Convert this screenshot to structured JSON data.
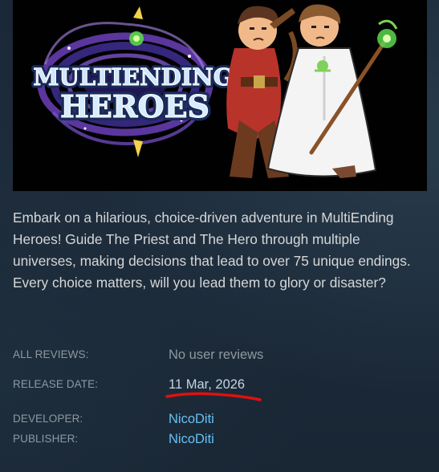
{
  "game": {
    "logo_line1": "MULTIENDING",
    "logo_line2": "HEROES",
    "description": "Embark on a hilarious, choice-driven adventure in MultiEnding Heroes! Guide The Priest and The Hero through multiple universes, making decisions that lead to over 75 unique endings. Every choice matters, will you lead them to glory or disaster?"
  },
  "meta": {
    "reviews_label": "ALL REVIEWS:",
    "reviews_value": "No user reviews",
    "release_label": "RELEASE DATE:",
    "release_value": "11 Mar, 2026",
    "developer_label": "DEVELOPER:",
    "developer_value": "NicoDiti",
    "publisher_label": "PUBLISHER:",
    "publisher_value": "NicoDiti"
  },
  "colors": {
    "background": "#1b2838",
    "label": "#8f98a0",
    "link": "#66c0f4",
    "description_text": "#d6d7d8",
    "annotation_underline": "#e01010"
  }
}
